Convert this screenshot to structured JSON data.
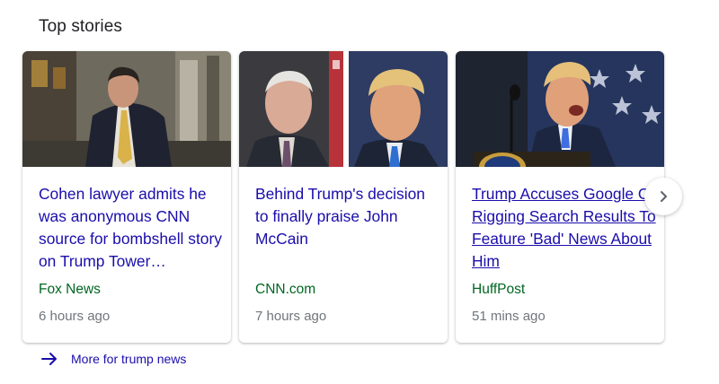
{
  "section": {
    "title": "Top stories"
  },
  "stories": [
    {
      "headline": "Cohen lawyer admits he was anonymous CNN source for bombshell story on Trump Tower…",
      "source": "Fox News",
      "time": "6 hours ago",
      "image": "photo-man-in-suit-on-street"
    },
    {
      "headline": "Behind Trump's decision to finally praise John McCain",
      "source": "CNN.com",
      "time": "7 hours ago",
      "image": "photo-two-portraits-side-by-side"
    },
    {
      "headline": "Trump Accuses Google Of Rigging Search Results To Feature 'Bad' News About Him",
      "source": "HuffPost",
      "time": "51 mins ago",
      "image": "photo-speaker-at-podium-with-flag"
    }
  ],
  "carousel": {
    "next_icon": "chevron-right-icon"
  },
  "more_link": {
    "label": "More for trump news",
    "icon": "arrow-right-icon"
  },
  "colors": {
    "headline_link": "#1a0dab",
    "source": "#006621",
    "time": "#70757a",
    "title": "#202124"
  }
}
